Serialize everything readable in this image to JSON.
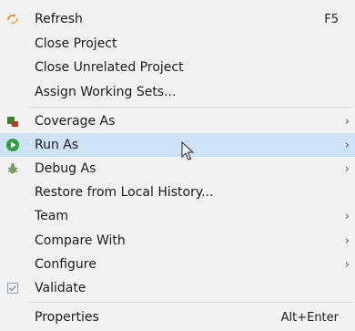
{
  "menu": {
    "items": [
      {
        "label": "Refresh",
        "shortcut": "F5",
        "submenu": false
      },
      {
        "label": "Close Project",
        "shortcut": "",
        "submenu": false
      },
      {
        "label": "Close Unrelated Project",
        "shortcut": "",
        "submenu": false
      },
      {
        "label": "Assign Working Sets...",
        "shortcut": "",
        "submenu": false
      },
      {
        "label": "Coverage As",
        "shortcut": "",
        "submenu": true
      },
      {
        "label": "Run As",
        "shortcut": "",
        "submenu": true,
        "highlighted": true
      },
      {
        "label": "Debug As",
        "shortcut": "",
        "submenu": true
      },
      {
        "label": "Restore from Local History...",
        "shortcut": "",
        "submenu": false
      },
      {
        "label": "Team",
        "shortcut": "",
        "submenu": true
      },
      {
        "label": "Compare With",
        "shortcut": "",
        "submenu": true
      },
      {
        "label": "Configure",
        "shortcut": "",
        "submenu": true
      },
      {
        "label": "Validate",
        "shortcut": "",
        "submenu": false
      },
      {
        "label": "Properties",
        "shortcut": "Alt+Enter",
        "submenu": false
      }
    ],
    "submenu_arrow": "›",
    "icons": {
      "refresh": "refresh-icon",
      "coverage": "coverage-icon",
      "run": "run-icon",
      "debug": "debug-icon",
      "validate": "validate-checkbox-icon"
    },
    "colors": {
      "background": "#f2f2f2",
      "highlight": "#cfe3f6",
      "run_green": "#2ea043"
    }
  }
}
